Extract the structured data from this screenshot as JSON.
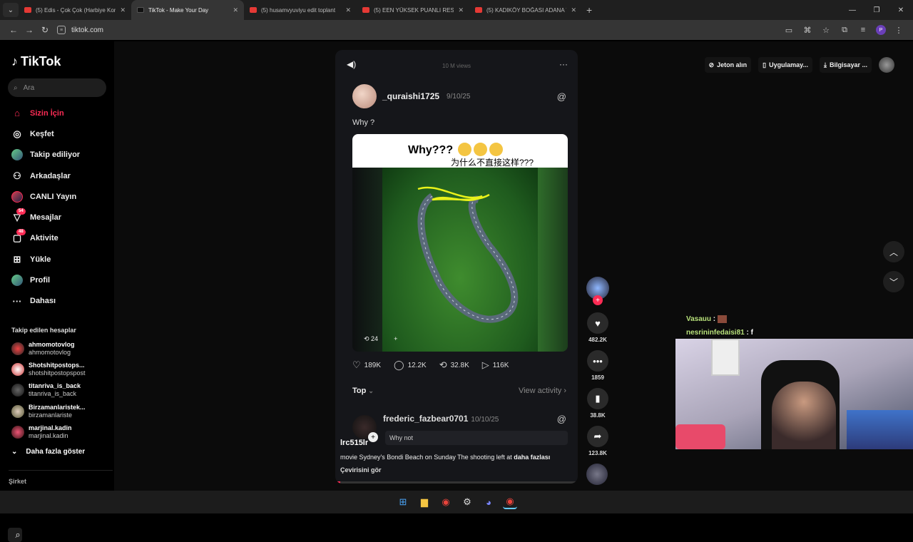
{
  "browser": {
    "tabs": [
      {
        "title": "(5) Edis - Çok Çok (Harbiye Kon",
        "active": false
      },
      {
        "title": "TikTok - Make Your Day",
        "active": true
      },
      {
        "title": "(5) husamvyuviyu edit toplant",
        "active": false
      },
      {
        "title": "(5) EEN YÜKSEK PUANLI RESTO",
        "active": false
      },
      {
        "title": "(5) KADIKÖY BOĞASI ADANA Y",
        "active": false
      }
    ],
    "url": "tiktok.com"
  },
  "tiktok": {
    "logo": "TikTok",
    "search_placeholder": "Ara",
    "nav": [
      {
        "label": "Sizin İçin",
        "icon": "home-icon",
        "active": true
      },
      {
        "label": "Keşfet",
        "icon": "compass-icon"
      },
      {
        "label": "Takip ediliyor",
        "icon": "avatar-icon"
      },
      {
        "label": "Arkadaşlar",
        "icon": "friends-icon"
      },
      {
        "label": "CANLI Yayın",
        "icon": "live-icon"
      },
      {
        "label": "Mesajlar",
        "icon": "messages-icon",
        "badge": "54"
      },
      {
        "label": "Aktivite",
        "icon": "activity-icon",
        "badge": "48"
      },
      {
        "label": "Yükle",
        "icon": "upload-icon"
      },
      {
        "label": "Profil",
        "icon": "profile-icon"
      },
      {
        "label": "Dahası",
        "icon": "more-icon"
      }
    ],
    "following_title": "Takip edilen hesaplar",
    "following": [
      {
        "name": "ahmomotovlog",
        "handle": "ahmomotovlog"
      },
      {
        "name": "Shotshitpostops...",
        "handle": "shotshitpostopspost"
      },
      {
        "name": "titanriva_is_back",
        "handle": "titanriva_is_back"
      },
      {
        "name": "Birzamanlaristek...",
        "handle": "birzamanlariste"
      },
      {
        "name": "marjinal.kadin",
        "handle": "marjinal.kadin"
      }
    ],
    "show_more": "Daha fazla göster",
    "company": "Şirket",
    "top_actions": {
      "coins": "Jeton alın",
      "app": "Uygulamay...",
      "desktop": "Bilgisayar ..."
    }
  },
  "video": {
    "views": "10 M views",
    "post_user": "_quraishi1725",
    "post_date": "9/10/25",
    "post_text": "Why ?",
    "media_title": "Why???",
    "media_subtitle": "为什么不直接这样???",
    "repost_count": "24",
    "likes": "189K",
    "comments": "12.2K",
    "reposts": "32.8K",
    "shares": "116K",
    "sort": "Top",
    "view_activity": "View activity",
    "comment_user": "frederic_fazbear0701",
    "comment_date": "10/10/25",
    "comment_text": "Why not",
    "overlay_user": "lrc515lr",
    "caption": "movie Sydney's Bondi Beach on Sunday The shooting left at",
    "caption_more": "daha fazlası",
    "translate": "Çevirisini gör",
    "progress": 0.02
  },
  "actions": {
    "likes": "482.2K",
    "comments": "1859",
    "saves": "38.8K",
    "shares": "123.8K"
  },
  "stream": {
    "chat": [
      {
        "user": "Vasauu",
        "message": ""
      },
      {
        "user": "nesrininfedaisi81",
        "message": "f"
      }
    ]
  }
}
